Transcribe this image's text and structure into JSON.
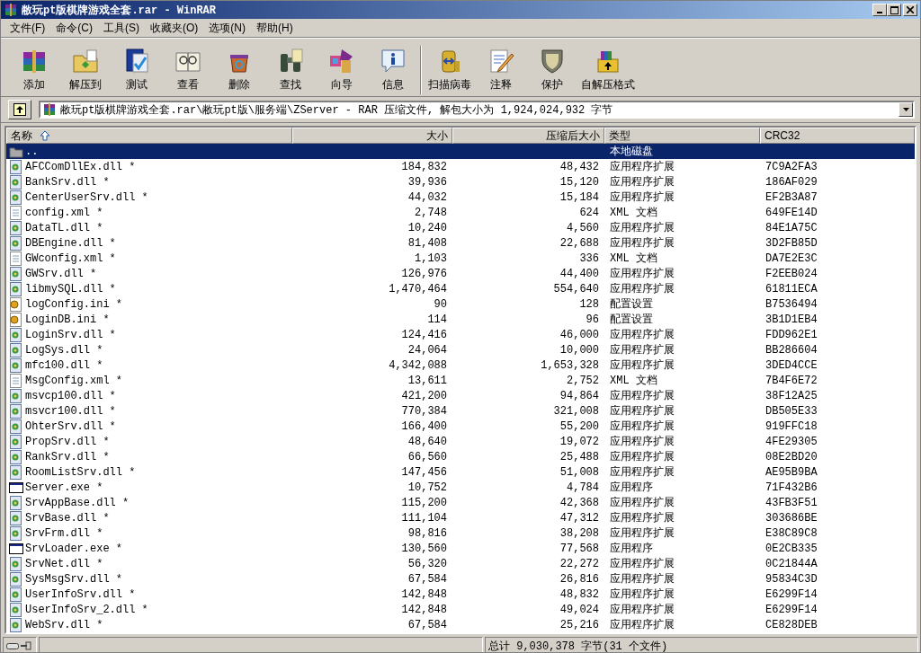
{
  "window": {
    "title": "敝玩pt版棋牌游戏全套.rar - WinRAR"
  },
  "menu": [
    "文件(F)",
    "命令(C)",
    "工具(S)",
    "收藏夹(O)",
    "选项(N)",
    "帮助(H)"
  ],
  "toolbar": [
    {
      "label": "添加"
    },
    {
      "label": "解压到"
    },
    {
      "label": "测试"
    },
    {
      "label": "查看"
    },
    {
      "label": "删除"
    },
    {
      "label": "查找"
    },
    {
      "label": "向导"
    },
    {
      "label": "信息"
    },
    {
      "label": "扫描病毒"
    },
    {
      "label": "注释"
    },
    {
      "label": "保护"
    },
    {
      "label": "自解压格式"
    }
  ],
  "address": {
    "path": "敝玩pt版棋牌游戏全套.rar\\敝玩pt版\\服务端\\ZServer - RAR 压缩文件, 解包大小为 1,924,024,932 字节"
  },
  "table": {
    "columns": [
      "名称",
      "大小",
      "压缩后大小",
      "类型",
      "CRC32"
    ],
    "rows": [
      {
        "kind": "folder",
        "name": "..",
        "type": "本地磁盘",
        "selected": true
      },
      {
        "kind": "dll",
        "name": "AFCComDllEx.dll *",
        "size": "184,832",
        "packed": "48,432",
        "type": "应用程序扩展",
        "crc": "7C9A2FA3",
        "selected": false
      },
      {
        "kind": "dll",
        "name": "BankSrv.dll *",
        "size": "39,936",
        "packed": "15,120",
        "type": "应用程序扩展",
        "crc": "186AF029",
        "selected": false
      },
      {
        "kind": "dll",
        "name": "CenterUserSrv.dll *",
        "size": "44,032",
        "packed": "15,184",
        "type": "应用程序扩展",
        "crc": "EF2B3A87",
        "selected": false
      },
      {
        "kind": "xml",
        "name": "config.xml *",
        "size": "2,748",
        "packed": "624",
        "type": "XML 文档",
        "crc": "649FE14D",
        "selected": false
      },
      {
        "kind": "dll",
        "name": "DataTL.dll *",
        "size": "10,240",
        "packed": "4,560",
        "type": "应用程序扩展",
        "crc": "84E1A75C",
        "selected": false
      },
      {
        "kind": "dll",
        "name": "DBEngine.dll *",
        "size": "81,408",
        "packed": "22,688",
        "type": "应用程序扩展",
        "crc": "3D2FB85D",
        "selected": false
      },
      {
        "kind": "xml",
        "name": "GWconfig.xml *",
        "size": "1,103",
        "packed": "336",
        "type": "XML 文档",
        "crc": "DA7E2E3C",
        "selected": false
      },
      {
        "kind": "dll",
        "name": "GWSrv.dll *",
        "size": "126,976",
        "packed": "44,400",
        "type": "应用程序扩展",
        "crc": "F2EEB024",
        "selected": false
      },
      {
        "kind": "dll",
        "name": "libmySQL.dll *",
        "size": "1,470,464",
        "packed": "554,640",
        "type": "应用程序扩展",
        "crc": "61811ECA",
        "selected": false
      },
      {
        "kind": "ini",
        "name": "logConfig.ini *",
        "size": "90",
        "packed": "128",
        "type": "配置设置",
        "crc": "B7536494",
        "selected": false
      },
      {
        "kind": "ini",
        "name": "LoginDB.ini *",
        "size": "114",
        "packed": "96",
        "type": "配置设置",
        "crc": "3B1D1EB4",
        "selected": false
      },
      {
        "kind": "dll",
        "name": "LoginSrv.dll *",
        "size": "124,416",
        "packed": "46,000",
        "type": "应用程序扩展",
        "crc": "FDD962E1",
        "selected": false
      },
      {
        "kind": "dll",
        "name": "LogSys.dll *",
        "size": "24,064",
        "packed": "10,000",
        "type": "应用程序扩展",
        "crc": "BB286604",
        "selected": false
      },
      {
        "kind": "dll",
        "name": "mfc100.dll *",
        "size": "4,342,088",
        "packed": "1,653,328",
        "type": "应用程序扩展",
        "crc": "3DED4CCE",
        "selected": false
      },
      {
        "kind": "xml",
        "name": "MsgConfig.xml *",
        "size": "13,611",
        "packed": "2,752",
        "type": "XML 文档",
        "crc": "7B4F6E72",
        "selected": false
      },
      {
        "kind": "dll",
        "name": "msvcp100.dll *",
        "size": "421,200",
        "packed": "94,864",
        "type": "应用程序扩展",
        "crc": "38F12A25",
        "selected": false
      },
      {
        "kind": "dll",
        "name": "msvcr100.dll *",
        "size": "770,384",
        "packed": "321,008",
        "type": "应用程序扩展",
        "crc": "DB505E33",
        "selected": false
      },
      {
        "kind": "dll",
        "name": "OhterSrv.dll *",
        "size": "166,400",
        "packed": "55,200",
        "type": "应用程序扩展",
        "crc": "919FFC18",
        "selected": false
      },
      {
        "kind": "dll",
        "name": "PropSrv.dll *",
        "size": "48,640",
        "packed": "19,072",
        "type": "应用程序扩展",
        "crc": "4FE29305",
        "selected": false
      },
      {
        "kind": "dll",
        "name": "RankSrv.dll *",
        "size": "66,560",
        "packed": "25,488",
        "type": "应用程序扩展",
        "crc": "08E2BD20",
        "selected": false
      },
      {
        "kind": "dll",
        "name": "RoomListSrv.dll *",
        "size": "147,456",
        "packed": "51,008",
        "type": "应用程序扩展",
        "crc": "AE95B9BA",
        "selected": false
      },
      {
        "kind": "exe",
        "name": "Server.exe *",
        "size": "10,752",
        "packed": "4,784",
        "type": "应用程序",
        "crc": "71F432B6",
        "selected": false
      },
      {
        "kind": "dll",
        "name": "SrvAppBase.dll *",
        "size": "115,200",
        "packed": "42,368",
        "type": "应用程序扩展",
        "crc": "43FB3F51",
        "selected": false
      },
      {
        "kind": "dll",
        "name": "SrvBase.dll *",
        "size": "111,104",
        "packed": "47,312",
        "type": "应用程序扩展",
        "crc": "303686BE",
        "selected": false
      },
      {
        "kind": "dll",
        "name": "SrvFrm.dll *",
        "size": "98,816",
        "packed": "38,208",
        "type": "应用程序扩展",
        "crc": "E38C89C8",
        "selected": false
      },
      {
        "kind": "exe",
        "name": "SrvLoader.exe *",
        "size": "130,560",
        "packed": "77,568",
        "type": "应用程序",
        "crc": "0E2CB335",
        "selected": false
      },
      {
        "kind": "dll",
        "name": "SrvNet.dll *",
        "size": "56,320",
        "packed": "22,272",
        "type": "应用程序扩展",
        "crc": "0C21844A",
        "selected": false
      },
      {
        "kind": "dll",
        "name": "SysMsgSrv.dll *",
        "size": "67,584",
        "packed": "26,816",
        "type": "应用程序扩展",
        "crc": "95834C3D",
        "selected": false
      },
      {
        "kind": "dll",
        "name": "UserInfoSrv.dll *",
        "size": "142,848",
        "packed": "48,832",
        "type": "应用程序扩展",
        "crc": "E6299F14",
        "selected": false
      },
      {
        "kind": "dll",
        "name": "UserInfoSrv_2.dll *",
        "size": "142,848",
        "packed": "49,024",
        "type": "应用程序扩展",
        "crc": "E6299F14",
        "selected": false
      },
      {
        "kind": "dll",
        "name": "WebSrv.dll *",
        "size": "67,584",
        "packed": "25,216",
        "type": "应用程序扩展",
        "crc": "CE828DEB",
        "selected": false
      }
    ]
  },
  "status_bar": {
    "summary": "总计 9,030,378 字节(31 个文件)"
  }
}
